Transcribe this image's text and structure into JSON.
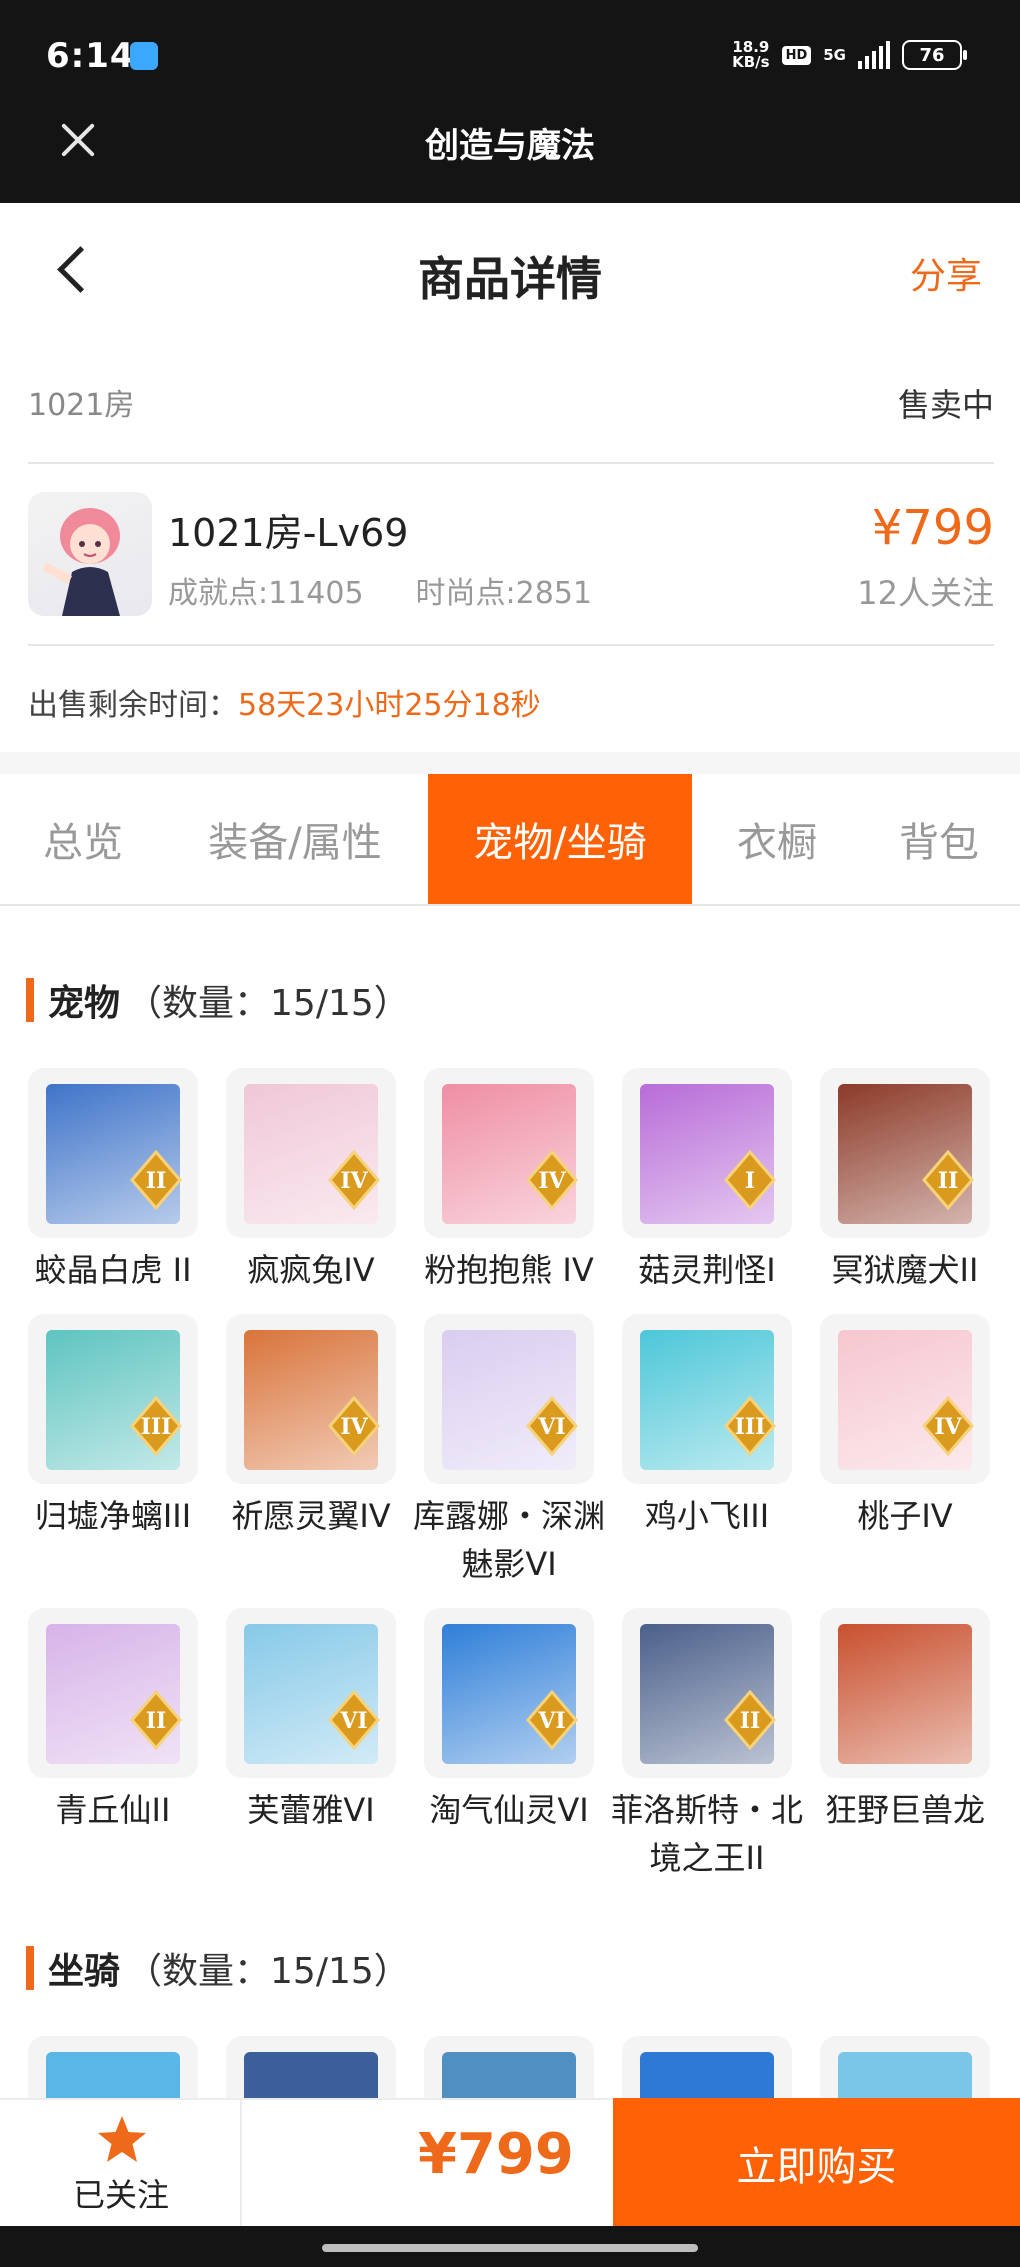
{
  "status": {
    "time": "6:14",
    "net_speed_top": "18.9",
    "net_speed_bottom": "KB/s",
    "hd": "HD",
    "network": "5G",
    "battery": "76"
  },
  "app_bar": {
    "title": "创造与魔法"
  },
  "nav": {
    "title": "商品详情",
    "share": "分享"
  },
  "seller": {
    "server": "1021房",
    "status": "售卖中"
  },
  "product": {
    "title": "1021房-Lv69",
    "achievement": "成就点:11405",
    "fashion": "时尚点:2851",
    "price": "¥799",
    "followers": "12人关注"
  },
  "remaining": {
    "label": "出售剩余时间：",
    "time": "58天23小时25分18秒"
  },
  "tabs": [
    "总览",
    "装备/属性",
    "宠物/坐骑",
    "衣橱",
    "背包"
  ],
  "active_tab_index": 2,
  "pets_section": {
    "title": "宠物",
    "count": "（数量：15/15）"
  },
  "pets": [
    {
      "name": "蛟晶白虎 II",
      "rank": "II",
      "color": "#3f74c9"
    },
    {
      "name": "疯疯兔IV",
      "rank": "IV",
      "color": "#f0c7d7"
    },
    {
      "name": "粉抱抱熊 IV",
      "rank": "IV",
      "color": "#ef8ea4"
    },
    {
      "name": "菇灵荆怪I",
      "rank": "I",
      "color": "#b86cd8"
    },
    {
      "name": "冥狱魔犬II",
      "rank": "II",
      "color": "#8c3a28"
    },
    {
      "name": "归墟净螭III",
      "rank": "III",
      "color": "#5ec4c0"
    },
    {
      "name": "祈愿灵翼IV",
      "rank": "IV",
      "color": "#d9743b"
    },
    {
      "name": "库露娜・深渊魅影VI",
      "rank": "VI",
      "color": "#d9cdf0"
    },
    {
      "name": "鸡小飞III",
      "rank": "III",
      "color": "#4cc7d8"
    },
    {
      "name": "桃子IV",
      "rank": "IV",
      "color": "#f6c6cf"
    },
    {
      "name": "青丘仙II",
      "rank": "II",
      "color": "#d7b3e8"
    },
    {
      "name": "芙蕾雅VI",
      "rank": "VI",
      "color": "#86c9e8"
    },
    {
      "name": "淘气仙灵VI",
      "rank": "VI",
      "color": "#2f7fd8"
    },
    {
      "name": "菲洛斯特・北境之王II",
      "rank": "II",
      "color": "#4a5f8a"
    },
    {
      "name": "狂野巨兽龙",
      "rank": "",
      "color": "#c8502e"
    }
  ],
  "mounts_section": {
    "title": "坐骑",
    "count": "（数量：15/15）"
  },
  "mounts_preview_colors": [
    "#5ab6e6",
    "#3b5f9a",
    "#4f8fc2",
    "#2e78d6",
    "#7ac6e8"
  ],
  "bottom": {
    "follow_label": "已关注",
    "price": "¥799",
    "buy_label": "立即购买"
  }
}
